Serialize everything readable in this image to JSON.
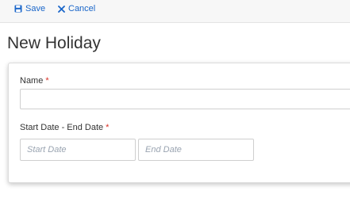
{
  "toolbar": {
    "save_label": "Save",
    "cancel_label": "Cancel",
    "save_icon": "floppy-disk-icon",
    "cancel_icon": "close-x-icon",
    "accent_color": "#1a66c9"
  },
  "page": {
    "title": "New Holiday"
  },
  "form": {
    "name": {
      "label": "Name",
      "required_marker": "*",
      "value": "",
      "placeholder": ""
    },
    "date_range": {
      "label": "Start Date - End Date",
      "required_marker": "*",
      "start_placeholder": "Start Date",
      "end_placeholder": "End Date",
      "start_value": "",
      "end_value": ""
    }
  }
}
